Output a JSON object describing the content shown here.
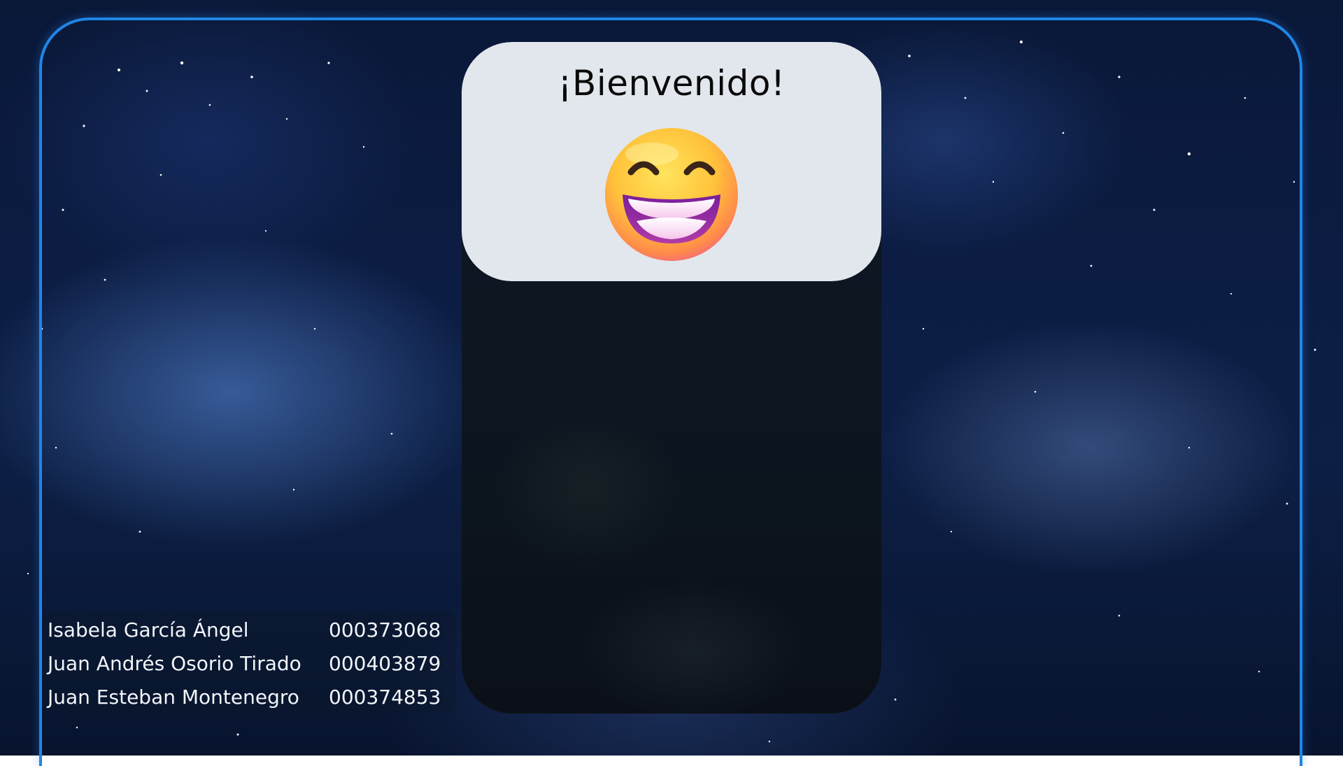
{
  "welcome": {
    "title": "¡Bienvenido!",
    "emoji_icon": "grinning-face-with-smiling-eyes-icon"
  },
  "credits": [
    {
      "name": "Isabela García Ángel",
      "id": "000373068"
    },
    {
      "name": "Juan Andrés Osorio Tirado",
      "id": "000403879"
    },
    {
      "name": "Juan Esteban Montenegro",
      "id": "000374853"
    }
  ],
  "colors": {
    "frame_border": "#1f86e6",
    "panel_background": "#e2e7ed",
    "card_background": "#0c1520",
    "text_light": "#f2f5fa",
    "text_dark": "#0a0a0a"
  }
}
